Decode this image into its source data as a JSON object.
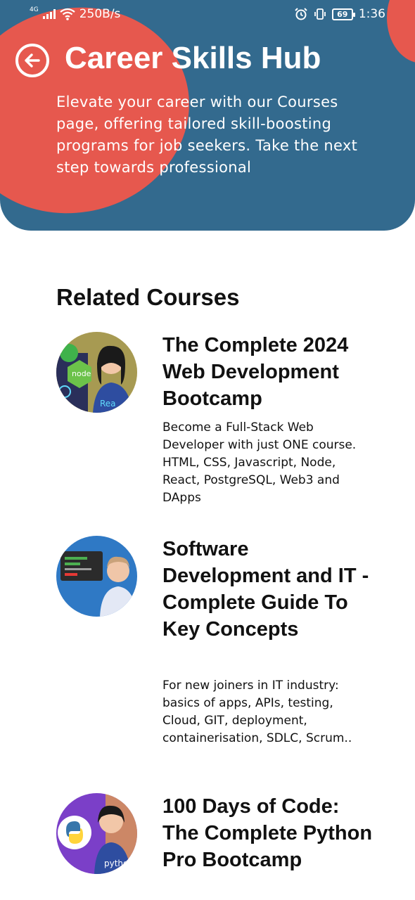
{
  "status_bar": {
    "network": "4G",
    "speed": "250B/s",
    "battery": "69",
    "time": "1:36",
    "icons": [
      "signal-icon",
      "wifi-icon",
      "alarm-icon",
      "vibrate-icon",
      "battery-icon"
    ]
  },
  "header": {
    "title": "Career Skills Hub",
    "description": "Elevate your career with our Courses page, offering tailored skill-boosting programs for job seekers. Take the next step towards professional",
    "back_icon": "back-arrow-icon",
    "colors": {
      "background": "#336a8e",
      "accent": "#e6584e"
    }
  },
  "section": {
    "title": "Related Courses"
  },
  "courses": [
    {
      "title": "The Complete 2024 Web Development Bootcamp",
      "description": "Become a Full-Stack Web Developer with just ONE course. HTML, CSS, Javascript, Node, React, PostgreSQL, Web3 and DApps",
      "thumb_labels": [
        "node",
        "Rea"
      ]
    },
    {
      "title": "Software Development and IT - Complete Guide To Key Concepts",
      "description": "For new joiners in IT industry: basics of apps, APIs, testing, Cloud, GIT, deployment, containerisation, SDLC, Scrum..",
      "thumb_labels": []
    },
    {
      "title": "100 Days of Code: The Complete Python Pro Bootcamp",
      "description": "",
      "thumb_labels": [
        "pytho"
      ]
    }
  ]
}
